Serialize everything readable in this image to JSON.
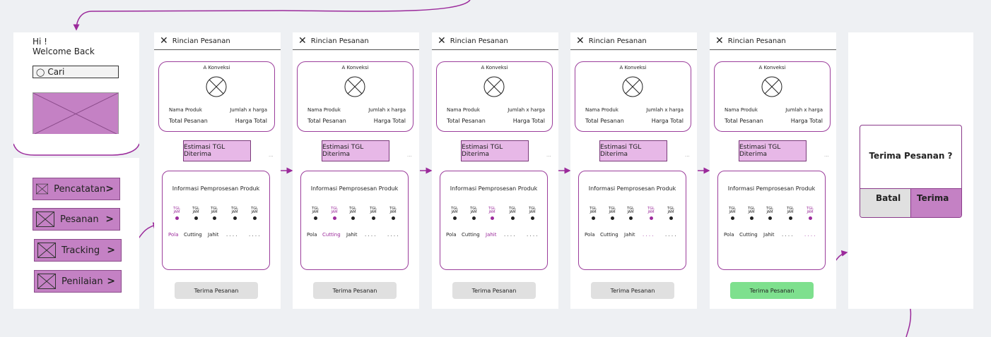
{
  "home": {
    "greeting": "Hi !",
    "welcome": "Welcome Back",
    "search_placeholder": "Cari",
    "menu": [
      {
        "label": "Pencatatan"
      },
      {
        "label": "Pesanan"
      },
      {
        "label": "Tracking"
      },
      {
        "label": "Penilaian"
      }
    ]
  },
  "screen": {
    "header_title": "Rincian Pesanan",
    "store_name": "A Konveksi",
    "nama_produk": "Nama Produk",
    "jumlah_harga": "Jumlah x harga",
    "total_pesanan": "Total Pesanan",
    "harga_total": "Harga Total",
    "estimasi": "Estimasi TGL Diterima",
    "info_title": "Informasi Pemprosesan Produk",
    "step_tgl": "TGL",
    "step_jam": "JAM",
    "steps": [
      "Pola",
      "Cutting",
      "Jahit",
      ". . . .",
      ". . . ."
    ],
    "button": "Terima Pesanan",
    "dots": "..."
  },
  "screens": [
    {
      "active_step": 0,
      "button_style": "gray"
    },
    {
      "active_step": 1,
      "button_style": "gray"
    },
    {
      "active_step": 2,
      "button_style": "gray"
    },
    {
      "active_step": 3,
      "button_style": "gray"
    },
    {
      "active_step": 4,
      "button_style": "green"
    }
  ],
  "dialog": {
    "question": "Terima Pesanan ?",
    "cancel_label": "Batal",
    "accept_label": "Terima"
  },
  "colors": {
    "accent": "#9b2a9b",
    "menu_fill": "#c481c4",
    "green": "#7ee08e"
  }
}
